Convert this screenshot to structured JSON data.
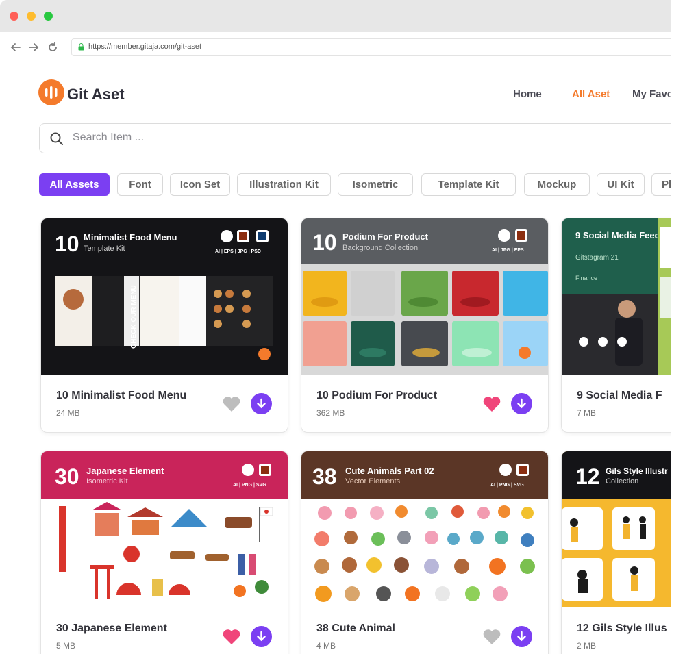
{
  "browser": {
    "url": "https://member.gitaja.com/git-aset"
  },
  "brand": {
    "name": "Git Aset"
  },
  "nav": [
    {
      "label": "Home",
      "active": false
    },
    {
      "label": "All Aset",
      "active": true
    },
    {
      "label": "My Favo",
      "active": false
    }
  ],
  "search": {
    "placeholder": "Search Item ..."
  },
  "filters": [
    {
      "label": "All Assets",
      "active": true
    },
    {
      "label": "Font"
    },
    {
      "label": "Icon Set"
    },
    {
      "label": "Illustration Kit"
    },
    {
      "label": "Isometric"
    },
    {
      "label": "Template Kit"
    },
    {
      "label": "Mockup"
    },
    {
      "label": "UI Kit"
    },
    {
      "label": "Pl"
    }
  ],
  "cards": [
    {
      "title": "10 Minimalist Food Menu",
      "size": "24 MB",
      "favorited": false,
      "banner": {
        "number": "10",
        "title": "Minimalist Food Menu",
        "subtitle": "Template Kit",
        "formats": "AI | EPS | JPG | PSD",
        "bg": "#141417",
        "menu_text": "CHECK OUR MENU"
      }
    },
    {
      "title": "10 Podium For Product",
      "size": "362 MB",
      "favorited": true,
      "banner": {
        "number": "10",
        "title": "Podium For Product",
        "subtitle": "Background Collection",
        "formats": "AI | JPG | EPS",
        "bg": "#5a5d61"
      }
    },
    {
      "title": "9 Social Media F",
      "size": "7 MB",
      "favorited": false,
      "banner": {
        "title": "9 Social Media Feed",
        "subtitle": "Gitstagram 21",
        "tag": "Finance",
        "bg": "#1f5f4c"
      }
    },
    {
      "title": "30 Japanese Element",
      "size": "5 MB",
      "favorited": true,
      "banner": {
        "number": "30",
        "title": "Japanese Element",
        "subtitle": "Isometric Kit",
        "formats": "AI | PNG | SVG",
        "bg": "#c9245a"
      }
    },
    {
      "title": "38 Cute Animal",
      "size": "4 MB",
      "favorited": false,
      "banner": {
        "number": "38",
        "title": "Cute Animals Part 02",
        "subtitle": "Vector Elements",
        "formats": "AI | PNG | SVG",
        "bg": "#5b3626"
      }
    },
    {
      "title": "12 Gils Style Illus",
      "size": "2 MB",
      "favorited": false,
      "banner": {
        "number": "12",
        "title": "Gils Style Illustr",
        "subtitle": "Collection",
        "bg": "#141417"
      }
    }
  ],
  "colors": {
    "accent": "#7b3ff2",
    "brand": "#f47a2b",
    "heart_active": "#f0457a",
    "heart_inactive": "#bdbdbd"
  },
  "icons": [
    "lock-icon",
    "back-icon",
    "forward-icon",
    "reload-icon",
    "search-icon",
    "heart-icon",
    "download-icon"
  ]
}
